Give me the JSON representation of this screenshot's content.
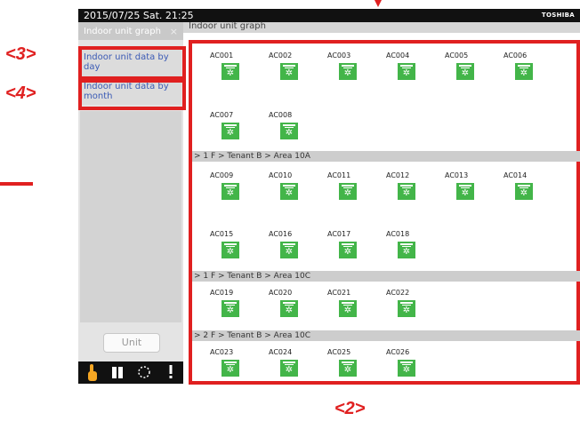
{
  "annotations": {
    "label3": "<3>",
    "label4": "<4>",
    "label2": "<2>"
  },
  "status": {
    "datetime": "2015/07/25  Sat.  21:25",
    "brand": "TOSHIBA"
  },
  "tab": {
    "label": "Indoor unit graph",
    "close": "×"
  },
  "title": "Indoor unit graph",
  "sidebar": {
    "items": [
      {
        "label": "Indoor unit data by day"
      },
      {
        "label": "Indoor unit data by month"
      }
    ],
    "unit_button": "Unit"
  },
  "bottom_bar": {
    "icons": [
      "hand-pointer-icon",
      "book-icon",
      "spinner-icon",
      "alert-icon"
    ]
  },
  "groups": [
    {
      "path": "",
      "units": [
        "AC001",
        "AC002",
        "AC003",
        "AC004",
        "AC005",
        "AC006",
        "AC007",
        "AC008"
      ]
    },
    {
      "path": "> 1 F > Tenant B > Area 10A",
      "units": [
        "AC009",
        "AC010",
        "AC011",
        "AC012",
        "AC013",
        "AC014",
        "AC015",
        "AC016",
        "AC017",
        "AC018"
      ]
    },
    {
      "path": "> 1 F > Tenant B > Area 10C",
      "units": [
        "AC019",
        "AC020",
        "AC021",
        "AC022"
      ]
    },
    {
      "path": "> 2 F > Tenant B > Area 10C",
      "units": [
        "AC023",
        "AC024",
        "AC025",
        "AC026"
      ]
    }
  ],
  "colors": {
    "unit_icon": "#43b549",
    "annotation_red": "#e02020",
    "link_blue": "#3b5bb5"
  }
}
